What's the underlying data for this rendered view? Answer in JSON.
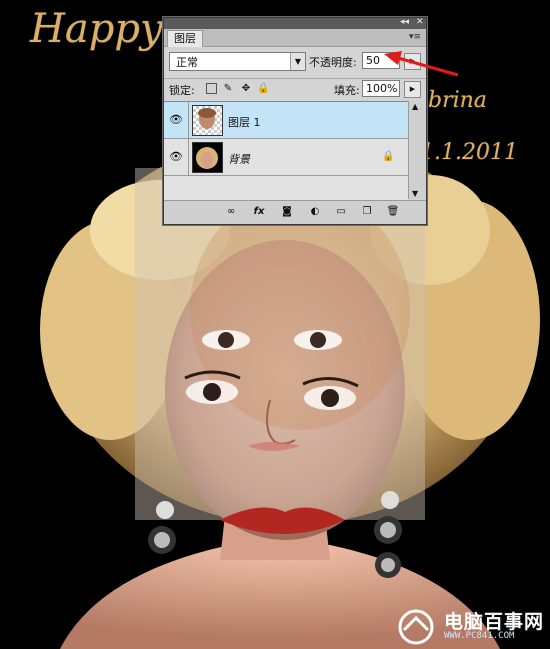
{
  "artwork": {
    "greeting_left": "Happy",
    "greeting_right": "brina",
    "greeting_date": "1.1.2011"
  },
  "panel": {
    "tab_label": "图层",
    "blend_mode": "正常",
    "opacity_label": "不透明度:",
    "opacity_value": "50",
    "lock_label": "锁定:",
    "fill_label": "填充:",
    "fill_value": "100%",
    "layers": [
      {
        "name": "图层 1",
        "selected": true,
        "visible": true,
        "locked": false
      },
      {
        "name": "背景",
        "selected": false,
        "visible": true,
        "locked": true
      }
    ],
    "bottom_icons": [
      "link-icon",
      "fx-icon",
      "mask-icon",
      "adjustment-icon",
      "group-icon",
      "new-layer-icon",
      "trash-icon"
    ]
  },
  "watermark": {
    "title": "电脑百事网",
    "url": "WWW.PC841.COM"
  },
  "colors": {
    "panel_bg": "#d4d4d4",
    "selected_row": "#c3e3f7",
    "annotation_arrow": "#e01b1b",
    "script_gold": "#d9b068"
  }
}
